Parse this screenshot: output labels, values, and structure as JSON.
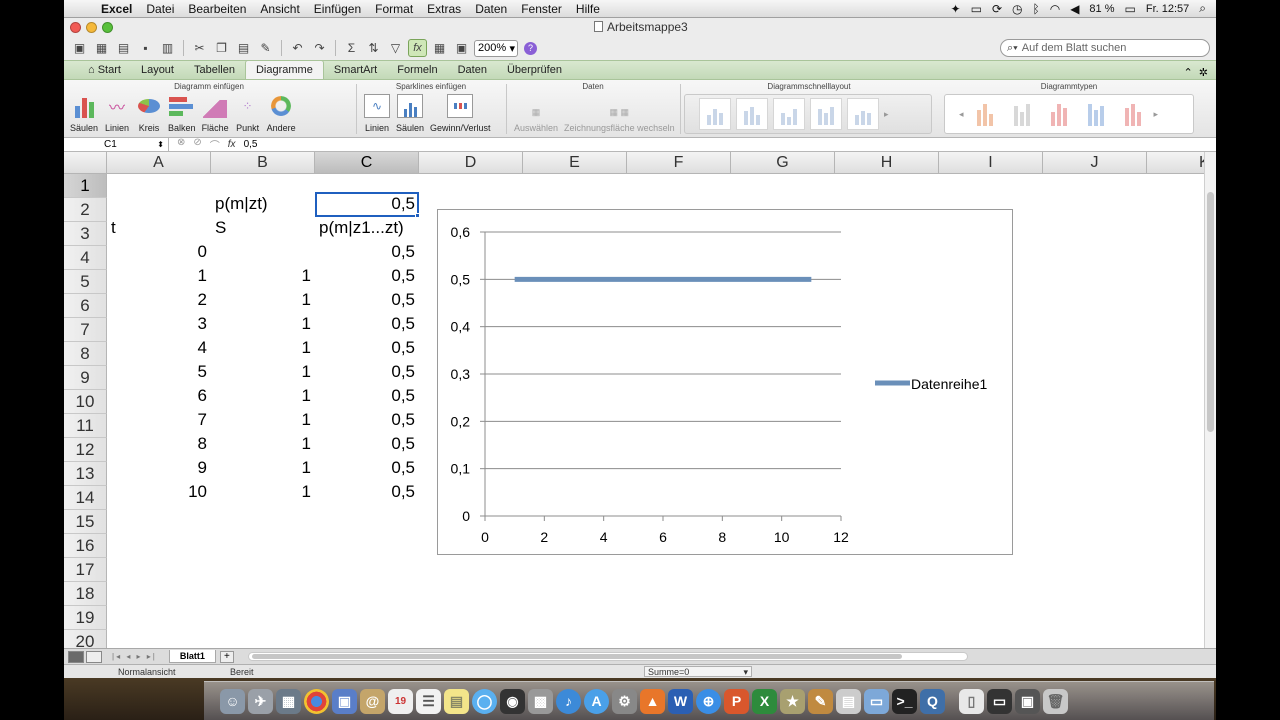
{
  "menubar": {
    "apple": "",
    "app_name": "Excel",
    "items": [
      "Datei",
      "Bearbeiten",
      "Ansicht",
      "Einfügen",
      "Format",
      "Extras",
      "Daten",
      "Fenster",
      "Hilfe"
    ],
    "battery": "81 %",
    "clock": "Fr. 12:57"
  },
  "window": {
    "title": "Arbeitsmappe3",
    "zoom": "200%",
    "search_placeholder": "Auf dem Blatt suchen",
    "fx_button": "fx"
  },
  "tabs": [
    "Start",
    "Layout",
    "Tabellen",
    "Diagramme",
    "SmartArt",
    "Formeln",
    "Daten",
    "Überprüfen"
  ],
  "active_tab": "Diagramme",
  "ribbon": {
    "groups": {
      "insert_chart": "Diagramm einfügen",
      "sparklines": "Sparklines einfügen",
      "data": "Daten",
      "quick_layout": "Diagrammschnelllayout",
      "chart_types": "Diagrammtypen"
    },
    "insert_buttons": [
      "Säulen",
      "Linien",
      "Kreis",
      "Balken",
      "Fläche",
      "Punkt",
      "Andere"
    ],
    "sparkline_buttons": [
      "Linien",
      "Säulen",
      "Gewinn/Verlust"
    ],
    "data_buttons": [
      "Auswählen",
      "Zeichnungsfläche wechseln"
    ]
  },
  "formula_bar": {
    "cell_ref": "C1",
    "fx": "fx",
    "value": "0,5"
  },
  "sheet": {
    "columns": [
      "A",
      "B",
      "C",
      "D",
      "E",
      "F",
      "G",
      "H",
      "I",
      "J",
      "K"
    ],
    "selected_column": "C",
    "rows": [
      "1",
      "2",
      "3",
      "4",
      "5",
      "6",
      "7",
      "8",
      "9",
      "10",
      "11",
      "12",
      "13",
      "14",
      "15",
      "16",
      "17",
      "18",
      "19",
      "20"
    ],
    "selected_row": "1",
    "cells": {
      "B1": "p(m|zt)",
      "C1": "0,5",
      "A2": "t",
      "B2": "S",
      "C2": "p(m|z1...zt)",
      "A3": "0",
      "C3": "0,5",
      "A4": "1",
      "B4": "1",
      "C4": "0,5",
      "A5": "2",
      "B5": "1",
      "C5": "0,5",
      "A6": "3",
      "B6": "1",
      "C6": "0,5",
      "A7": "4",
      "B7": "1",
      "C7": "0,5",
      "A8": "5",
      "B8": "1",
      "C8": "0,5",
      "A9": "6",
      "B9": "1",
      "C9": "0,5",
      "A10": "7",
      "B10": "1",
      "C10": "0,5",
      "A11": "8",
      "B11": "1",
      "C11": "0,5",
      "A12": "9",
      "B12": "1",
      "C12": "0,5",
      "A13": "10",
      "B13": "1",
      "C13": "0,5"
    },
    "sheet_tab": "Blatt1",
    "add_sheet": "+"
  },
  "status": {
    "view": "Normalansicht",
    "state": "Bereit",
    "sum": "Summe=0"
  },
  "chart_data": {
    "type": "line",
    "title": "",
    "xlabel": "",
    "ylabel": "",
    "x": [
      1,
      2,
      3,
      4,
      5,
      6,
      7,
      8,
      9,
      10,
      11
    ],
    "series": [
      {
        "name": "Datenreihe1",
        "values": [
          0.5,
          0.5,
          0.5,
          0.5,
          0.5,
          0.5,
          0.5,
          0.5,
          0.5,
          0.5,
          0.5
        ],
        "color": "#6a8fb9"
      }
    ],
    "xlim": [
      0,
      12
    ],
    "ylim": [
      0,
      0.6
    ],
    "x_ticks": [
      "0",
      "2",
      "4",
      "6",
      "8",
      "10",
      "12"
    ],
    "y_ticks": [
      "0",
      "0,1",
      "0,2",
      "0,3",
      "0,4",
      "0,5",
      "0,6"
    ],
    "grid": "horizontal",
    "legend": "right"
  }
}
